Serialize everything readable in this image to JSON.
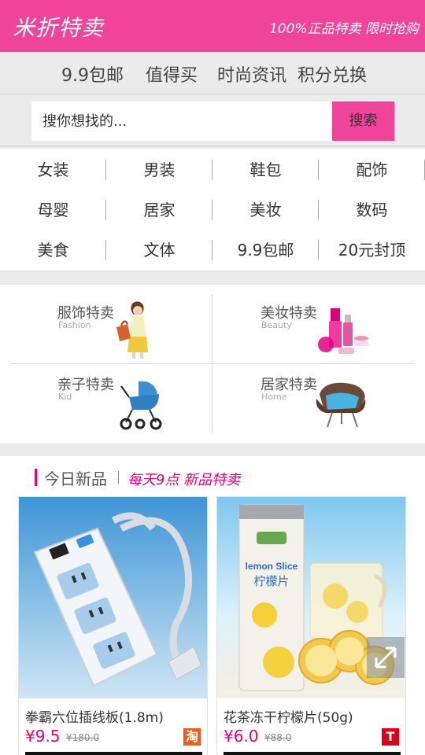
{
  "header": {
    "title": "米折特卖",
    "slogan": "100%正品特卖 限时抢购",
    "color": "#f0449b"
  },
  "topnav": [
    "9.9包邮",
    "值得买",
    "时尚资讯",
    "积分兑换"
  ],
  "search": {
    "placeholder": "搜你想找的...",
    "button": "搜索"
  },
  "categories": [
    [
      "女装",
      "男装",
      "鞋包",
      "配饰"
    ],
    [
      "母婴",
      "居家",
      "美妆",
      "数码"
    ],
    [
      "美食",
      "文体",
      "9.9包邮",
      "20元封顶"
    ]
  ],
  "features": [
    {
      "title": "服饰特卖",
      "sub": "Fashion",
      "icon": "woman-shopping-image"
    },
    {
      "title": "美妆特卖",
      "sub": "Beauty",
      "icon": "cosmetics-image"
    },
    {
      "title": "亲子特卖",
      "sub": "Kid",
      "icon": "stroller-image"
    },
    {
      "title": "居家特卖",
      "sub": "Home",
      "icon": "armchair-image"
    }
  ],
  "new_today": {
    "title": "今日新品",
    "subtitle": "每天9点 新品特卖",
    "products": [
      {
        "name": "拳霸六位插线板(1.8m)",
        "price": "¥9.5",
        "original_price": "¥180.0",
        "badge": "淘",
        "badge_color": "#f05a1a",
        "image": "power-strip-image"
      },
      {
        "name": "花茶冻干柠檬片(50g)",
        "price": "¥6.0",
        "original_price": "¥88.0",
        "badge": "T",
        "badge_color": "#d9001b",
        "image": "lemon-slice-image",
        "package_text_en": "lemon Slice",
        "package_text_cn": "柠檬片"
      }
    ]
  }
}
